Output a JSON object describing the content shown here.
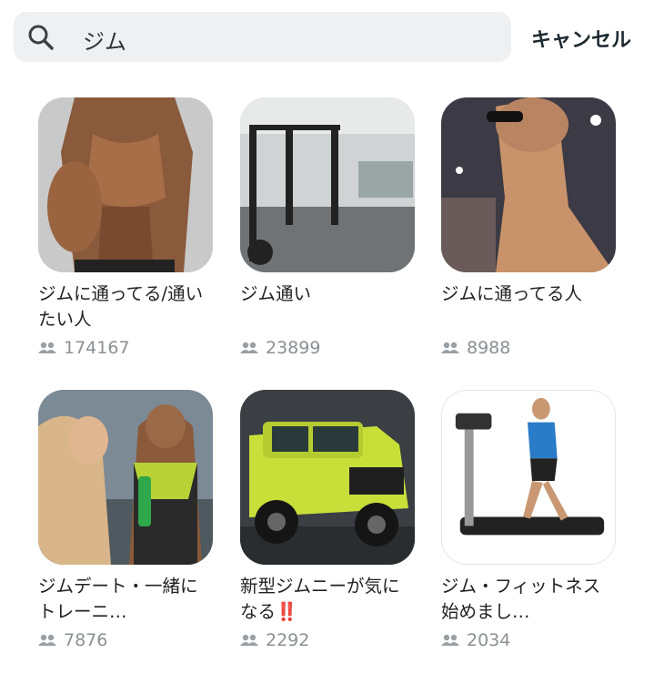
{
  "search": {
    "value": "ジム"
  },
  "cancel_label": "キャンセル",
  "communities": [
    {
      "name": "ジムに通ってる/通いたい人",
      "members": "174167"
    },
    {
      "name": "ジム通い",
      "members": "23899"
    },
    {
      "name": "ジムに通ってる人",
      "members": "8988"
    },
    {
      "name": "ジムデート・一緒にトレーニ…",
      "members": "7876"
    },
    {
      "name": "新型ジムニーが気になる",
      "name_suffix": "‼️",
      "members": "2292"
    },
    {
      "name": "ジム・フィットネス始めまし…",
      "members": "2034"
    }
  ],
  "colors": {
    "search_bg": "#eef0f1",
    "member_gray": "#8a9094",
    "cancel_text": "#1e2a30"
  },
  "icons": {
    "search": "magnifier-icon",
    "members": "people-icon"
  }
}
